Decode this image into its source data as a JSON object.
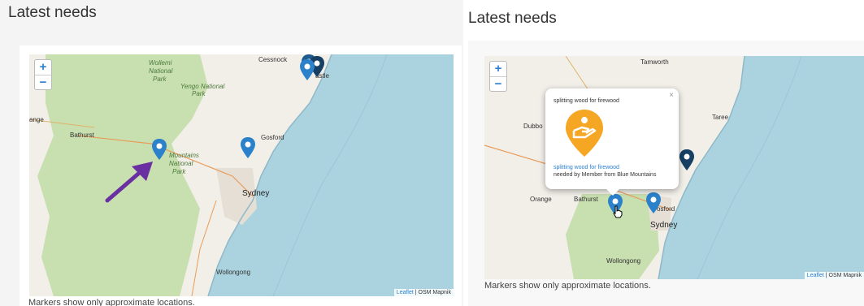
{
  "left": {
    "heading": "Latest needs",
    "note": "Markers show only approximate locations.",
    "attribution_link": "Leaflet",
    "attribution_rest": " | OSM Mapnik",
    "labels": {
      "wollemi": "Wollemi",
      "national": "National",
      "park": "Park",
      "yengo": "Yengo National",
      "yengo_park": "Park",
      "cessnock": "Cessnock",
      "castle": "astle",
      "ange": "ange",
      "bathurst": "Bathurst",
      "mountains": "Mountains",
      "bm_national": "National",
      "bm_park": "Park",
      "gosford": "Gosford",
      "sydney": "Sydney",
      "wollongong": "Wollongong"
    }
  },
  "right": {
    "heading": "Latest needs",
    "note": "Markers show only approximate locations.",
    "attribution_link": "Leaflet",
    "attribution_rest": " | OSM Mapnik",
    "labels": {
      "tamworth": "Tamworth",
      "dubbo": "Dubbo",
      "taree": "Taree",
      "orange": "Orange",
      "bathurst": "Bathurst",
      "gosford": "osford",
      "sydney": "Sydney",
      "wollongong": "Wollongong"
    },
    "popup": {
      "title": "splitting wood for firewood",
      "link": "splitting wood for firewood",
      "sub": "needed by Member from Blue Mountains",
      "close": "×"
    }
  },
  "zoom_in": "+",
  "zoom_out": "−",
  "colors": {
    "marker": "#2b82cb",
    "sea": "#aad3df",
    "park": "#c8dfb0",
    "land": "#f2efe9",
    "arrow": "#6a2fa0",
    "popup_icon": "#f5a623"
  }
}
